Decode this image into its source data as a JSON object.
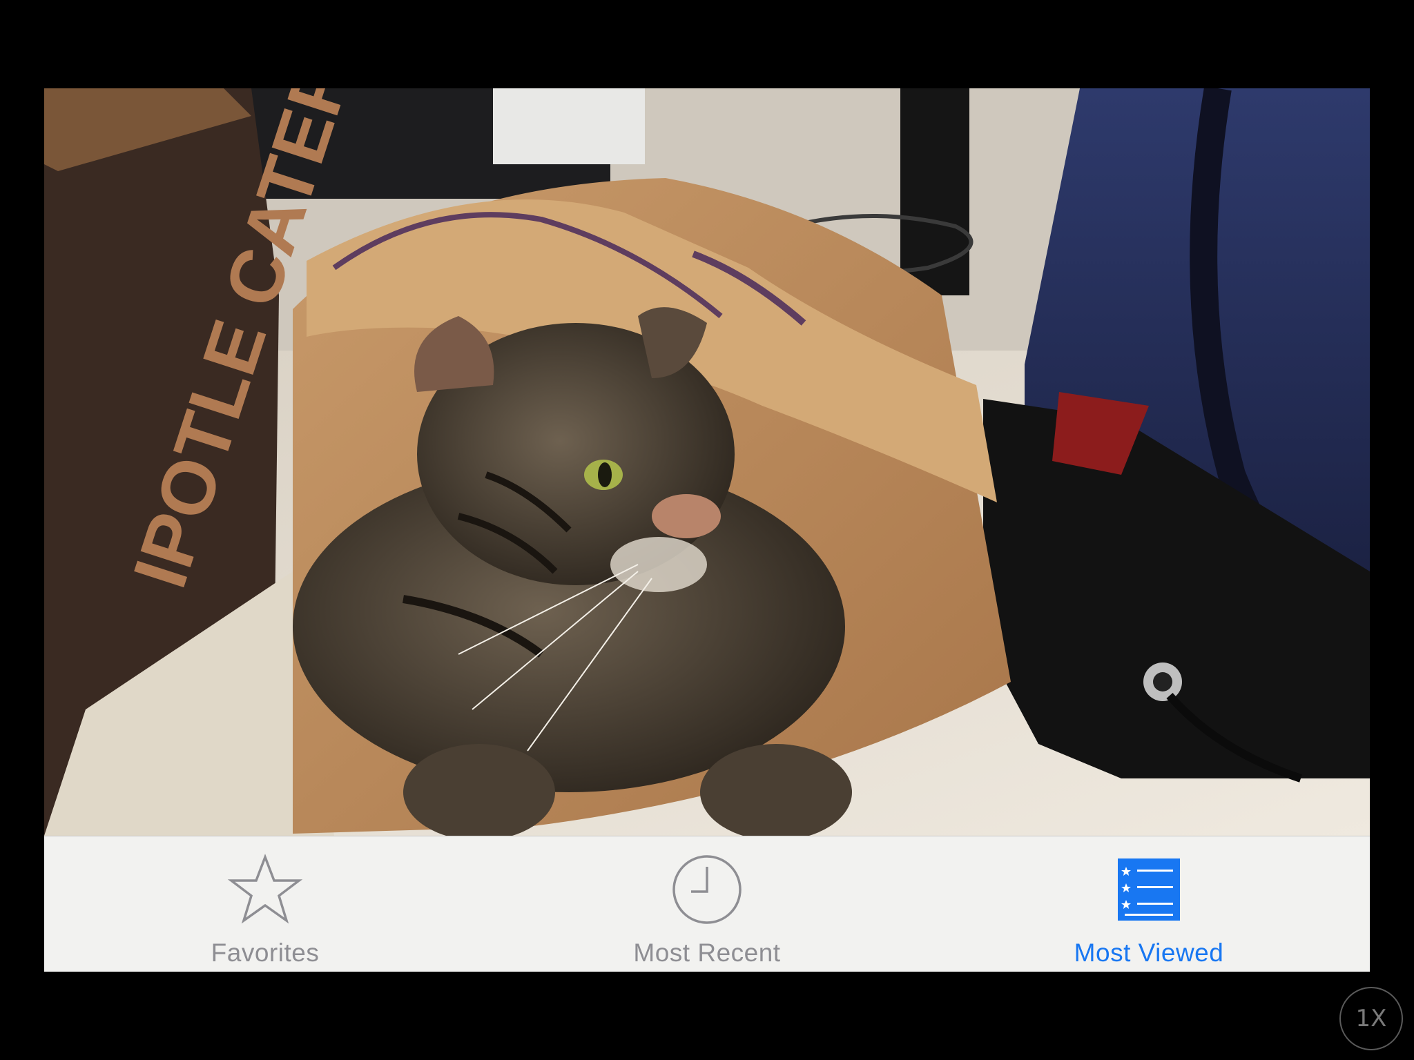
{
  "photo": {
    "subject": "tabby-cat-in-paper-bag",
    "box_text": "IPOTLE CATERING"
  },
  "tab_bar": {
    "items": [
      {
        "label": "Favorites",
        "icon": "star-icon",
        "selected": false
      },
      {
        "label": "Most Recent",
        "icon": "clock-icon",
        "selected": false
      },
      {
        "label": "Most Viewed",
        "icon": "list-star-icon",
        "selected": true
      }
    ]
  },
  "zoom_badge": {
    "label": "1X"
  },
  "colors": {
    "selected": "#1877f2",
    "unselected": "#8e8e93",
    "tab_bar_bg": "#f2f2f0"
  }
}
